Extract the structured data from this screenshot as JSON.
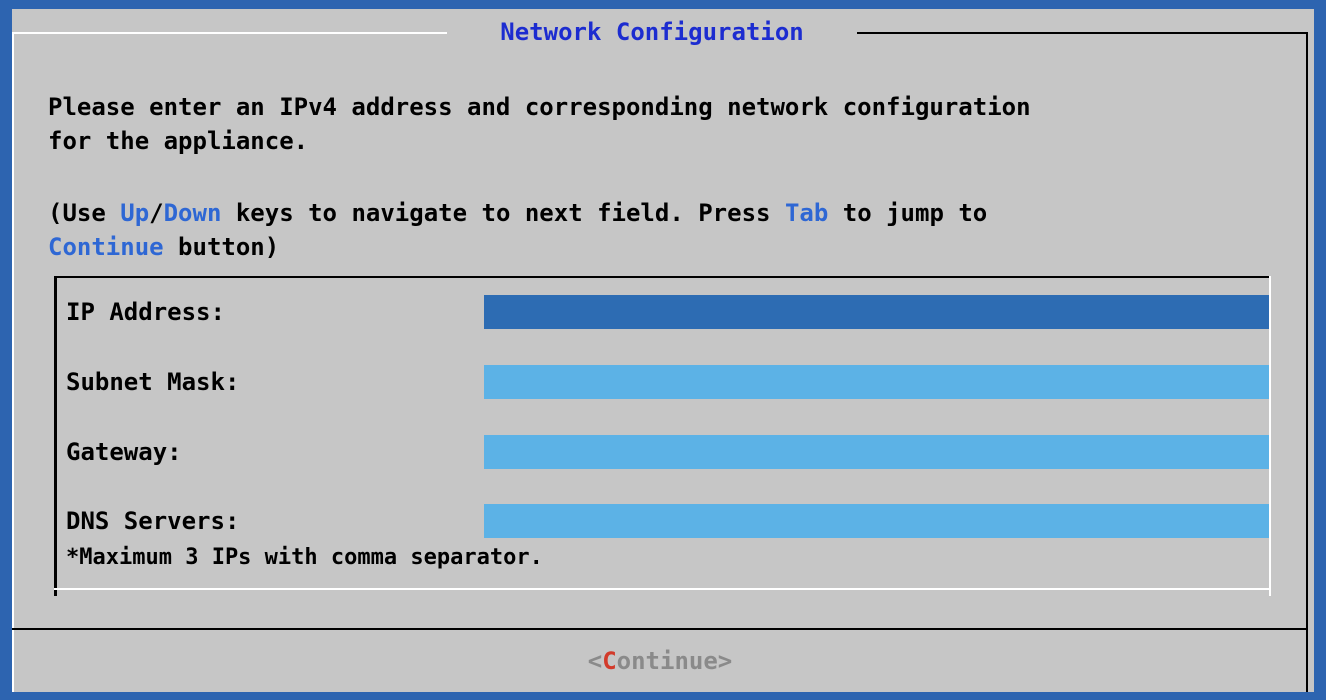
{
  "dialog": {
    "title": "Network Configuration",
    "intro_line1": "Please enter an IPv4 address and corresponding network configuration",
    "intro_line2": "for the appliance.",
    "hint": {
      "open_paren": "(Use ",
      "up": "Up",
      "slash": "/",
      "down": "Down",
      "mid": " keys to navigate to next field. Press ",
      "tab": "Tab",
      "end": " to jump to",
      "continue_word": "Continue",
      "button_close": " button)"
    }
  },
  "form": {
    "fields": [
      {
        "label": "IP Address:",
        "value": "",
        "active": true
      },
      {
        "label": "Subnet Mask:",
        "value": "",
        "active": false
      },
      {
        "label": "Gateway:",
        "value": "",
        "active": false
      },
      {
        "label": "DNS Servers:",
        "value": "",
        "active": false
      }
    ],
    "dns_note": "*Maximum 3 IPs with comma separator."
  },
  "footer": {
    "continue_left": "<",
    "continue_hotkey": "C",
    "continue_rest": "ontinue",
    "continue_right": ">"
  },
  "colors": {
    "screen_background": "#2d64b0",
    "dialog_background": "#c6c6c6",
    "title_color": "#1c2cd0",
    "key_highlight": "#2e67d4",
    "active_field": "#2d6cb3",
    "inactive_field": "#5cb2e6",
    "hotkey_color": "#d23a2a",
    "disabled_button_text": "#8a8a8a"
  }
}
